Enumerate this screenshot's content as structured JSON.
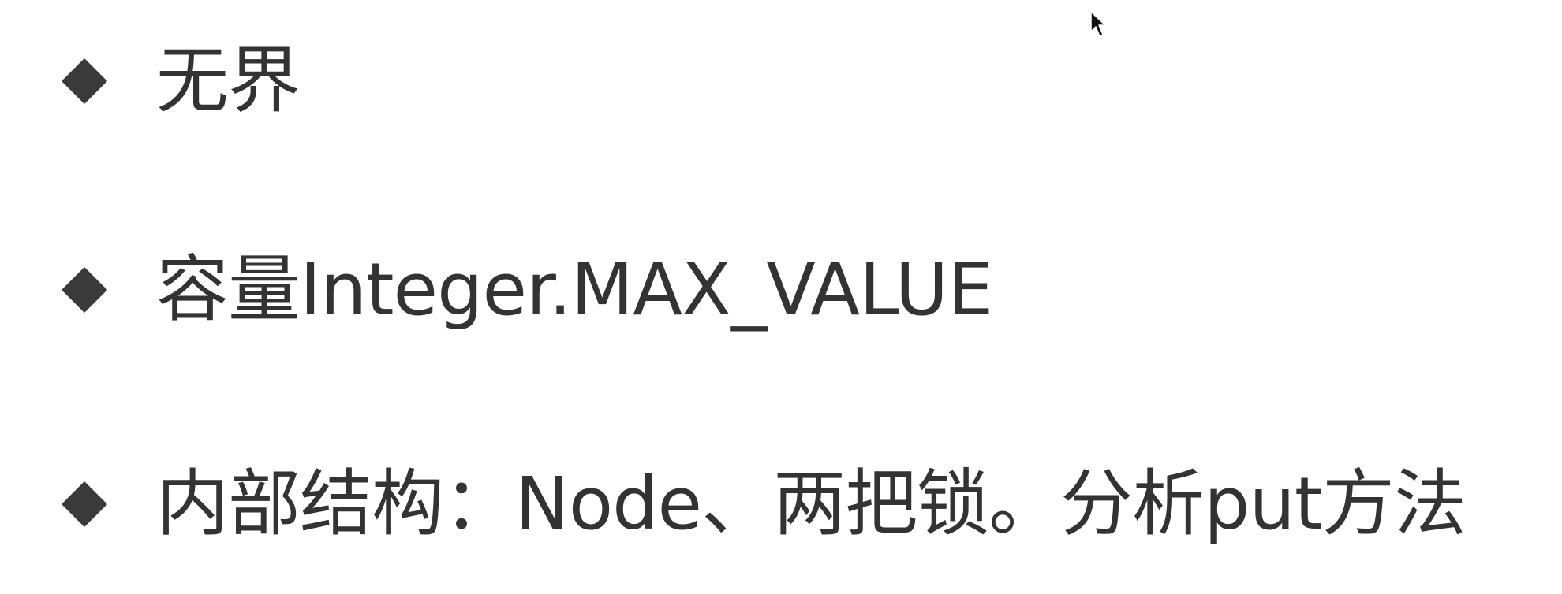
{
  "bullets": [
    {
      "text": "无界",
      "icon": "diamond-bullet-icon"
    },
    {
      "text": "容量Integer.MAX_VALUE",
      "icon": "diamond-bullet-icon"
    },
    {
      "text": "内部结构：Node、两把锁。分析put方法",
      "icon": "diamond-bullet-icon"
    }
  ],
  "colors": {
    "text": "#333333",
    "bullet": "#3a3a3a",
    "background": "#ffffff"
  },
  "cursor": {
    "icon": "mouse-pointer-icon"
  }
}
